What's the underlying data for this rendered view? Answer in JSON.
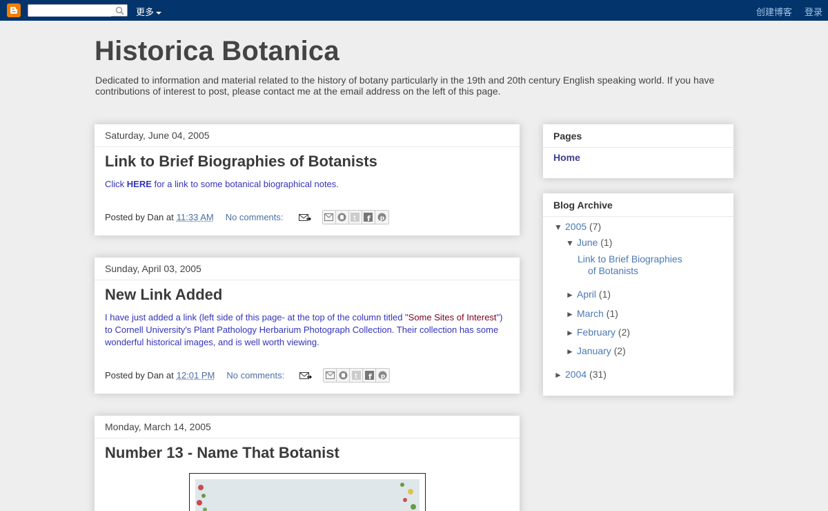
{
  "navbar": {
    "more_label": "更多",
    "create_blog_label": "创建博客",
    "login_label": "登录"
  },
  "header": {
    "title": "Historica Botanica",
    "description": "Dedicated to information and material related to the history of botany particularly in the 19th and 20th century English speaking world. If you have contributions of interest to post, please contact me at the email address on the left of this page."
  },
  "posts": [
    {
      "date": "Saturday, June 04, 2005",
      "title": "Link to Brief Biographies of Botanists",
      "body_pre": "Click ",
      "body_link": "HERE",
      "body_post": " for a link to some botanical biographical notes.",
      "posted_by": "Posted by Dan at",
      "time": "11:33 AM",
      "comments": "No comments:"
    },
    {
      "date": "Sunday, April 03, 2005",
      "title": "New Link Added",
      "body_pre": "I have just added a link (left side of this page- at the top of the column titled \"",
      "body_highlight": "Some Sites of Interest",
      "body_post": "\") to Cornell University's Plant Pathology Herbarium Photograph Collection. Their collection has some wonderful historical images, and is well worth viewing.",
      "posted_by": "Posted by Dan at",
      "time": "12:01 PM",
      "comments": "No comments:"
    },
    {
      "date": "Monday, March 14, 2005",
      "title": "Number 13 - Name That Botanist"
    }
  ],
  "sidebar": {
    "pages": {
      "heading": "Pages",
      "home": "Home"
    },
    "archive": {
      "heading": "Blog Archive",
      "year_2005": "2005",
      "year_2005_count": "(7)",
      "june": "June",
      "june_count": "(1)",
      "june_post": "Link to Brief Biographies of Botanists",
      "april": "April",
      "april_count": "(1)",
      "march": "March",
      "march_count": "(1)",
      "february": "February",
      "february_count": "(2)",
      "january": "January",
      "january_count": "(2)",
      "year_2004": "2004",
      "year_2004_count": "(31)",
      "expanded_symbol": "▼",
      "collapsed_symbol": "►"
    }
  },
  "colors": {
    "navbar": "#03346b",
    "link": "#4a79b5",
    "post_text": "#3333bb",
    "highlight": "#7a0022"
  }
}
